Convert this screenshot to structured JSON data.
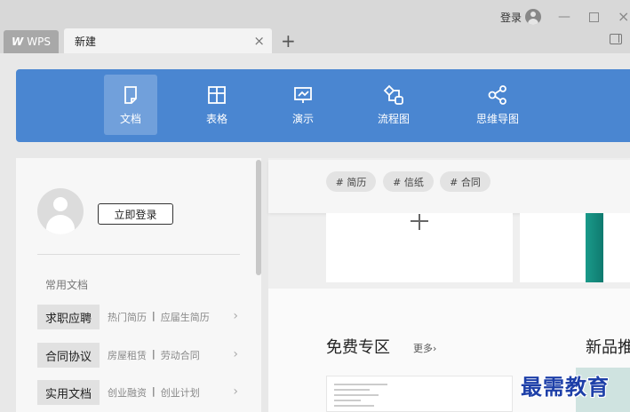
{
  "window": {
    "app_tab_label": "WPS",
    "active_tab_label": "新建",
    "tab_close": "×",
    "tab_add": "+",
    "login_label": "登录",
    "minimize": "—",
    "close": "×"
  },
  "categories": [
    {
      "label": "文档",
      "icon": "document-icon",
      "active": true
    },
    {
      "label": "表格",
      "icon": "table-icon",
      "active": false
    },
    {
      "label": "演示",
      "icon": "presentation-icon",
      "active": false
    },
    {
      "label": "流程图",
      "icon": "flowchart-icon",
      "active": false
    },
    {
      "label": "思维导图",
      "icon": "mindmap-icon",
      "active": false
    }
  ],
  "account": {
    "login_button": "立即登录"
  },
  "common_docs": {
    "title": "常用文档",
    "rows": [
      {
        "tag": "求职应聘",
        "link1": "热门简历",
        "sep": "|",
        "link2": "应届生简历",
        "arrow": "›"
      },
      {
        "tag": "合同协议",
        "link1": "房屋租赁",
        "sep": "|",
        "link2": "劳动合同",
        "arrow": "›"
      },
      {
        "tag": "实用文档",
        "link1": "创业融资",
        "sep": "|",
        "link2": "创业计划",
        "arrow": "›"
      }
    ]
  },
  "tags": [
    "# 简历",
    "# 信纸",
    "# 合同"
  ],
  "sections": {
    "free_title": "免费专区",
    "more_link": "更多›",
    "new_title": "新品推"
  },
  "watermark": "最需教育",
  "colors": {
    "category_bar": "#4a86d1",
    "teal_thumbnail": "#1a9a8a"
  }
}
